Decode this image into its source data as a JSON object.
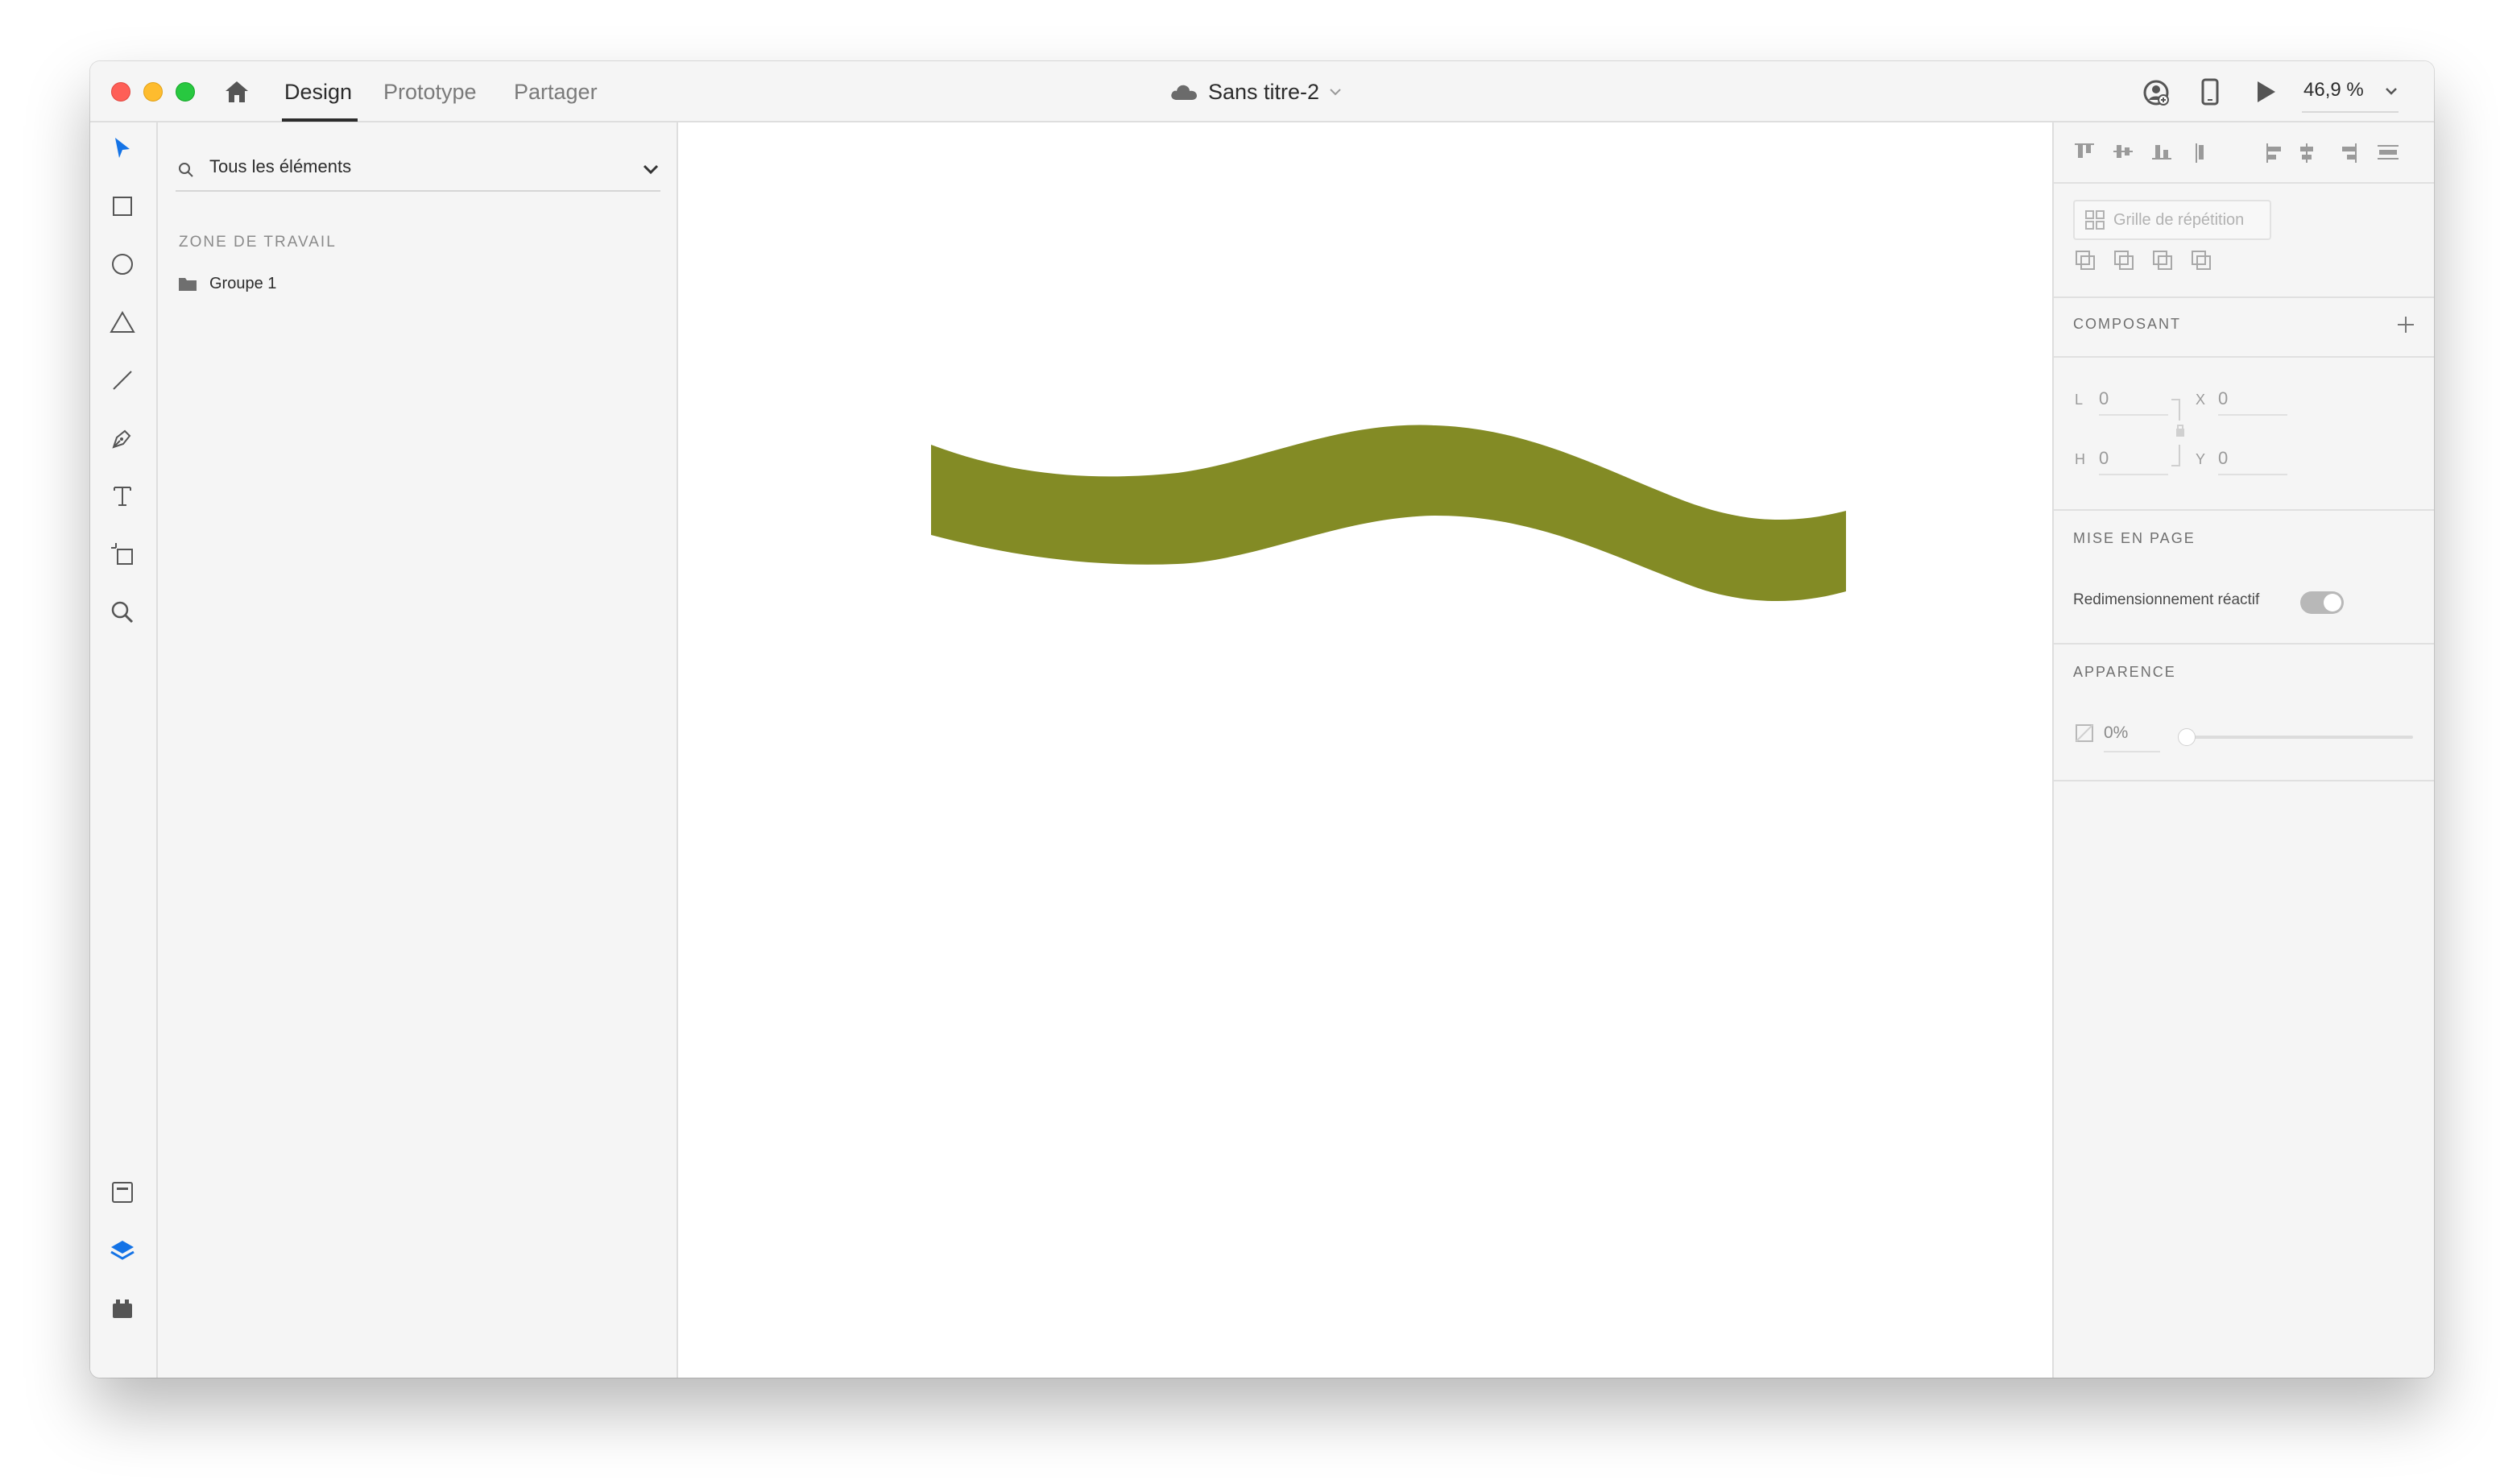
{
  "titlebar": {
    "tabs": [
      "Design",
      "Prototype",
      "Partager"
    ],
    "active_tab": "Design",
    "document_title": "Sans titre-2",
    "zoom": "46,9 %"
  },
  "layers": {
    "search_placeholder": "Tous les éléments",
    "section_label": "ZONE DE TRAVAIL",
    "items": [
      {
        "label": "Groupe 1",
        "icon": "folder-icon"
      }
    ]
  },
  "inspector": {
    "repeat_grid_label": "Grille de répétition",
    "component_label": "COMPOSANT",
    "width_label": "L",
    "width_value": "0",
    "height_label": "H",
    "height_value": "0",
    "x_label": "X",
    "x_value": "0",
    "y_label": "Y",
    "y_value": "0",
    "layout_label": "MISE EN PAGE",
    "responsive_label": "Redimensionnement réactif",
    "responsive_on": true,
    "appearance_label": "APPARENCE",
    "opacity_value": "0%",
    "opacity_fraction": 0
  },
  "canvas": {
    "shape_color": "#838b25"
  }
}
